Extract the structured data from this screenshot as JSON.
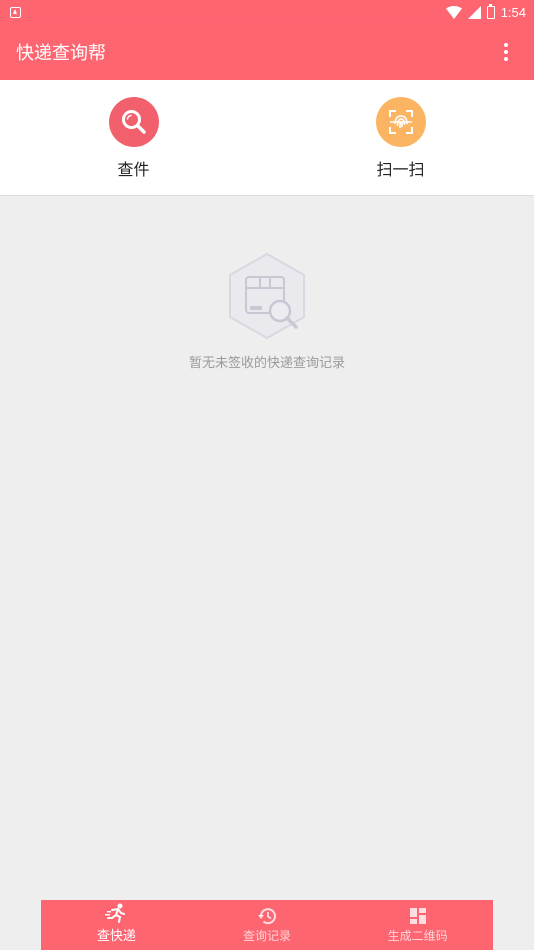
{
  "status_bar": {
    "time": "1:54",
    "icons": [
      "notification-icon",
      "wifi-icon",
      "signal-icon",
      "battery-icon"
    ]
  },
  "app_bar": {
    "title": "快递查询帮",
    "menu_icon": "more-vert-icon"
  },
  "actions": [
    {
      "label": "查件",
      "icon": "search-icon",
      "color": "#f2606d"
    },
    {
      "label": "扫一扫",
      "icon": "fingerprint-scan-icon",
      "color": "#fbb562"
    }
  ],
  "empty_state": {
    "icon": "package-search-icon",
    "text": "暂无未签收的快递查询记录"
  },
  "bottom_nav": {
    "items": [
      {
        "label": "查快递",
        "icon": "courier-runner-icon",
        "active": true
      },
      {
        "label": "查询记录",
        "icon": "history-icon",
        "active": false
      },
      {
        "label": "生成二维码",
        "icon": "dashboard-grid-icon",
        "active": false
      }
    ]
  },
  "colors": {
    "primary": "#fd6571",
    "background": "#eeeeee"
  }
}
